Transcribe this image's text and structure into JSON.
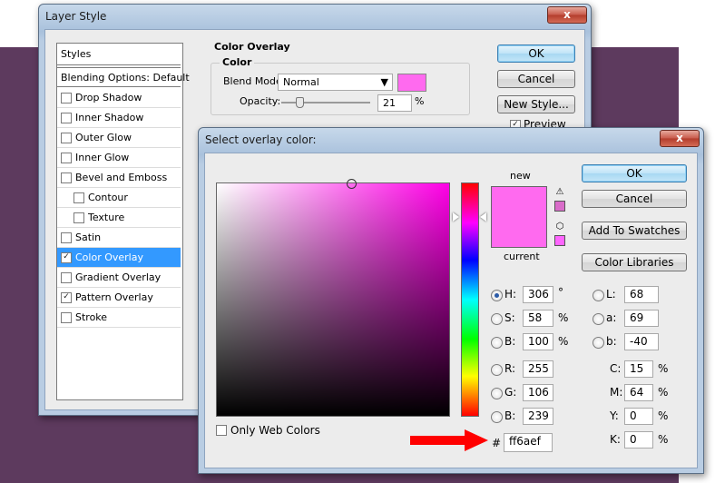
{
  "layer_style": {
    "title": "Layer Style",
    "close_label": "x",
    "styles_header": "Styles",
    "blending_options": "Blending Options: Default",
    "effects": [
      {
        "label": "Drop Shadow",
        "checked": false,
        "indent": false
      },
      {
        "label": "Inner Shadow",
        "checked": false,
        "indent": false
      },
      {
        "label": "Outer Glow",
        "checked": false,
        "indent": false
      },
      {
        "label": "Inner Glow",
        "checked": false,
        "indent": false
      },
      {
        "label": "Bevel and Emboss",
        "checked": false,
        "indent": false
      },
      {
        "label": "Contour",
        "checked": false,
        "indent": true
      },
      {
        "label": "Texture",
        "checked": false,
        "indent": true
      },
      {
        "label": "Satin",
        "checked": false,
        "indent": false
      },
      {
        "label": "Color Overlay",
        "checked": true,
        "indent": false,
        "selected": true
      },
      {
        "label": "Gradient Overlay",
        "checked": false,
        "indent": false
      },
      {
        "label": "Pattern Overlay",
        "checked": true,
        "indent": false
      },
      {
        "label": "Stroke",
        "checked": false,
        "indent": false
      }
    ],
    "section_title": "Color Overlay",
    "group_title": "Color",
    "blend_mode_label": "Blend Mode:",
    "blend_mode_value": "Normal",
    "opacity_label": "Opacity:",
    "opacity_value": "21",
    "opacity_unit": "%",
    "overlay_color": "#ff6aef",
    "ok": "OK",
    "cancel": "Cancel",
    "new_style": "New Style...",
    "preview_label": "Preview",
    "preview_checked": true
  },
  "color_picker": {
    "title": "Select overlay color:",
    "close_label": "x",
    "new_label": "new",
    "current_label": "current",
    "new_color": "#ff6aef",
    "current_color": "#ff6aef",
    "gamut_swatch": "#d96cc9",
    "web_swatch": "#ff66ff",
    "ok": "OK",
    "cancel": "Cancel",
    "add_to_swatches": "Add To Swatches",
    "color_libraries": "Color Libraries",
    "hsb": [
      {
        "name": "H:",
        "value": "306",
        "unit": "°",
        "selected": true
      },
      {
        "name": "S:",
        "value": "58",
        "unit": "%",
        "selected": false
      },
      {
        "name": "B:",
        "value": "100",
        "unit": "%",
        "selected": false
      }
    ],
    "rgb": [
      {
        "name": "R:",
        "value": "255"
      },
      {
        "name": "G:",
        "value": "106"
      },
      {
        "name": "B:",
        "value": "239"
      }
    ],
    "lab": [
      {
        "name": "L:",
        "value": "68"
      },
      {
        "name": "a:",
        "value": "69"
      },
      {
        "name": "b:",
        "value": "-40"
      }
    ],
    "cmyk": [
      {
        "name": "C:",
        "value": "15",
        "unit": "%"
      },
      {
        "name": "M:",
        "value": "64",
        "unit": "%"
      },
      {
        "name": "Y:",
        "value": "0",
        "unit": "%"
      },
      {
        "name": "K:",
        "value": "0",
        "unit": "%"
      }
    ],
    "only_web_colors": "Only Web Colors",
    "hex_prefix": "#",
    "hex_value": "ff6aef",
    "hue_fraction": 0.85,
    "arrow_color": "#ff0000"
  }
}
